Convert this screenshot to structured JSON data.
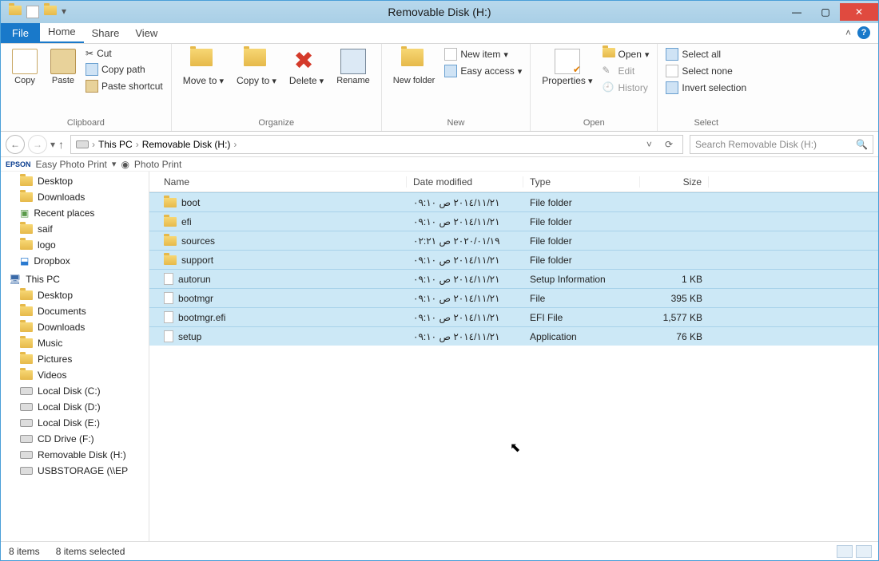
{
  "window": {
    "title": "Removable Disk (H:)"
  },
  "tabs": {
    "file": "File",
    "home": "Home",
    "share": "Share",
    "view": "View"
  },
  "ribbon": {
    "clipboard": {
      "label": "Clipboard",
      "copy": "Copy",
      "paste": "Paste",
      "cut": "Cut",
      "copypath": "Copy path",
      "pasteshortcut": "Paste shortcut"
    },
    "organize": {
      "label": "Organize",
      "moveto": "Move to",
      "copyto": "Copy to",
      "delete": "Delete",
      "rename": "Rename"
    },
    "new": {
      "label": "New",
      "newfolder": "New folder",
      "newitem": "New item",
      "easyaccess": "Easy access"
    },
    "open": {
      "label": "Open",
      "properties": "Properties",
      "open": "Open",
      "edit": "Edit",
      "history": "History"
    },
    "select": {
      "label": "Select",
      "selectall": "Select all",
      "selectnone": "Select none",
      "invert": "Invert selection"
    }
  },
  "breadcrumb": {
    "thispc": "This PC",
    "location": "Removable Disk (H:)"
  },
  "search": {
    "placeholder": "Search Removable Disk (H:)"
  },
  "epson": {
    "brand": "EPSON",
    "easy": "Easy Photo Print",
    "photo": "Photo Print"
  },
  "navpane": {
    "fav": [
      "Desktop",
      "Downloads",
      "Recent places",
      "saif",
      "logo",
      "Dropbox"
    ],
    "thispc_label": "This PC",
    "thispc": [
      "Desktop",
      "Documents",
      "Downloads",
      "Music",
      "Pictures",
      "Videos",
      "Local Disk (C:)",
      "Local Disk (D:)",
      "Local Disk (E:)",
      "CD Drive (F:)",
      "Removable Disk (H:)",
      "USBSTORAGE (\\\\EP"
    ]
  },
  "columns": {
    "name": "Name",
    "date": "Date modified",
    "type": "Type",
    "size": "Size"
  },
  "files": [
    {
      "icon": "folder",
      "name": "boot",
      "date": "٢٠١٤/١١/٢١ ص ٠٩:١٠",
      "type": "File folder",
      "size": ""
    },
    {
      "icon": "folder",
      "name": "efi",
      "date": "٢٠١٤/١١/٢١ ص ٠٩:١٠",
      "type": "File folder",
      "size": ""
    },
    {
      "icon": "folder",
      "name": "sources",
      "date": "٢٠٢٠/٠١/١٩ ص ٠٢:٢١",
      "type": "File folder",
      "size": ""
    },
    {
      "icon": "folder",
      "name": "support",
      "date": "٢٠١٤/١١/٢١ ص ٠٩:١٠",
      "type": "File folder",
      "size": ""
    },
    {
      "icon": "file",
      "name": "autorun",
      "date": "٢٠١٤/١١/٢١ ص ٠٩:١٠",
      "type": "Setup Information",
      "size": "1 KB"
    },
    {
      "icon": "file",
      "name": "bootmgr",
      "date": "٢٠١٤/١١/٢١ ص ٠٩:١٠",
      "type": "File",
      "size": "395 KB"
    },
    {
      "icon": "file",
      "name": "bootmgr.efi",
      "date": "٢٠١٤/١١/٢١ ص ٠٩:١٠",
      "type": "EFI File",
      "size": "1,577 KB"
    },
    {
      "icon": "file",
      "name": "setup",
      "date": "٢٠١٤/١١/٢١ ص ٠٩:١٠",
      "type": "Application",
      "size": "76 KB"
    }
  ],
  "status": {
    "items": "8 items",
    "selected": "8 items selected"
  }
}
